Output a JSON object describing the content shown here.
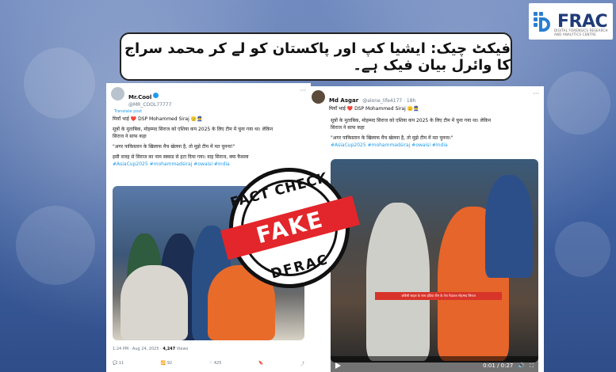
{
  "logo": {
    "text": "FRAC",
    "tagline": "DIGITAL FORENSICS RESEARCH AND ANALYTICS CENTRE"
  },
  "headline": "فیکٹ چیک: ایشیا کپ اور پاکستان کو لے کر محمد سراج کا وائرل بیان فیک ہے۔",
  "left_tweet": {
    "name": "Mr.Cool",
    "handle": "@MR_COOL77777",
    "translate": "Translate post",
    "line1": "मियाँ भाई ❤️ DSP Mohammed Siraj 🫡👮",
    "line2": "सूत्रों के मुताबिक, मोहम्मद सिराज को एशिया कप 2025 के लिए टीम में चुना गया था। लेकिन",
    "line3": "सिराज ने साफ कहा",
    "line4": "\"अगर पाकिस्तान के खिलाफ मैच खेलना है, तो मुझे टीम में मत चुनना!\"",
    "line5": "इसी वजह से सिराज का नाम स्क्वाड से हटा दिया गया। वाह सिराज, क्या फैसला",
    "hashtags": "#AsiaCup2025 #mohammadsiraj #owaisi #India",
    "time": "1:24 PM · Aug 24, 2025 ·",
    "views": "4,247",
    "views_label": "Views",
    "actions": [
      "11",
      "92",
      "425",
      "",
      ""
    ]
  },
  "right_tweet": {
    "name": "Md Asgar",
    "handle": "@alone_life4177 · 18h",
    "line1": "मियाँ भाई ❤️ DSP Mohammed Siraj 🫡👮",
    "line2": "सूत्रों के मुताबिक, मोहम्मद सिराज को एशिया कप 2025 के लिए टीम में चुना गया था। लेकिन",
    "line3": "सिराज ने साफ कहा",
    "line4": "\"अगर पाकिस्तान के खिलाफ मैच खेलना है, तो मुझे टीम में मत चुनना।\"",
    "hashtags": "#AsiaCup2025 #mohammadsiraj #owaisi #India",
    "caption": "ओवैसी साहब के साथ इंडिया टीम के तेज गेंदबाज मोहम्मद सिराज",
    "video_time": "0:01 / 0:27"
  },
  "stamp": {
    "top": "FACT CHECK",
    "band": "FAKE",
    "bottom": "DFRAC"
  },
  "colors": {
    "accent": "#e3262b",
    "link": "#1d9bf0",
    "brand": "#1f3c78"
  }
}
